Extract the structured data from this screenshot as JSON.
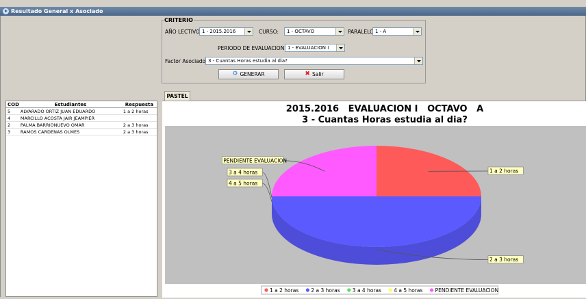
{
  "window": {
    "title": "Resultado General x Asociado"
  },
  "criterio": {
    "legend": "CRITERIO",
    "anio_label": "AÑO LECTIVO:",
    "anio_value": "1 - 2015.2016",
    "curso_label": "CURSO:",
    "curso_value": "1 - OCTAVO",
    "paralelo_label": "PARALELO:",
    "paralelo_value": "1 - A",
    "periodo_label": "PERIODO DE EVALUACION:",
    "periodo_value": "1 - EVALUACION I",
    "factor_label": "Factor Asociado:",
    "factor_value": "3 - Cuantas Horas estudia al dia?",
    "generar_label": "GENERAR",
    "salir_label": "Salir"
  },
  "tabs": [
    {
      "label": "PASTEL"
    }
  ],
  "table": {
    "headers": [
      "COD",
      "Estudiantes",
      "Respuesta"
    ],
    "rows": [
      [
        "5",
        "ALVARADO ORTIZ JUAN EDUARDO",
        "1 a 2 horas"
      ],
      [
        "4",
        "MARCILLO ACOSTA JAIR JEAMPIER",
        ""
      ],
      [
        "2",
        "PALMA BARRIONUEVO OMAR",
        "2 a 3 horas"
      ],
      [
        "3",
        "RAMOS CARDENAS OLMES",
        "2 a 3 horas"
      ]
    ]
  },
  "chart_data": {
    "type": "pie",
    "title": "2015.2016   EVALUACION I   OCTAVO   A",
    "subtitle": "3 - Cuantas Horas estudia al dia?",
    "categories": [
      "1 a 2 horas",
      "2 a 3 horas",
      "3 a 4 horas",
      "4 a 5 horas",
      "PENDIENTE EVALUACION"
    ],
    "values": [
      1,
      2,
      0,
      0,
      1
    ],
    "colors": [
      "#ff5a5a",
      "#5a5aff",
      "#5ae05a",
      "#ffff5a",
      "#ff5aff"
    ],
    "legend": "bottom",
    "style": "3d"
  }
}
